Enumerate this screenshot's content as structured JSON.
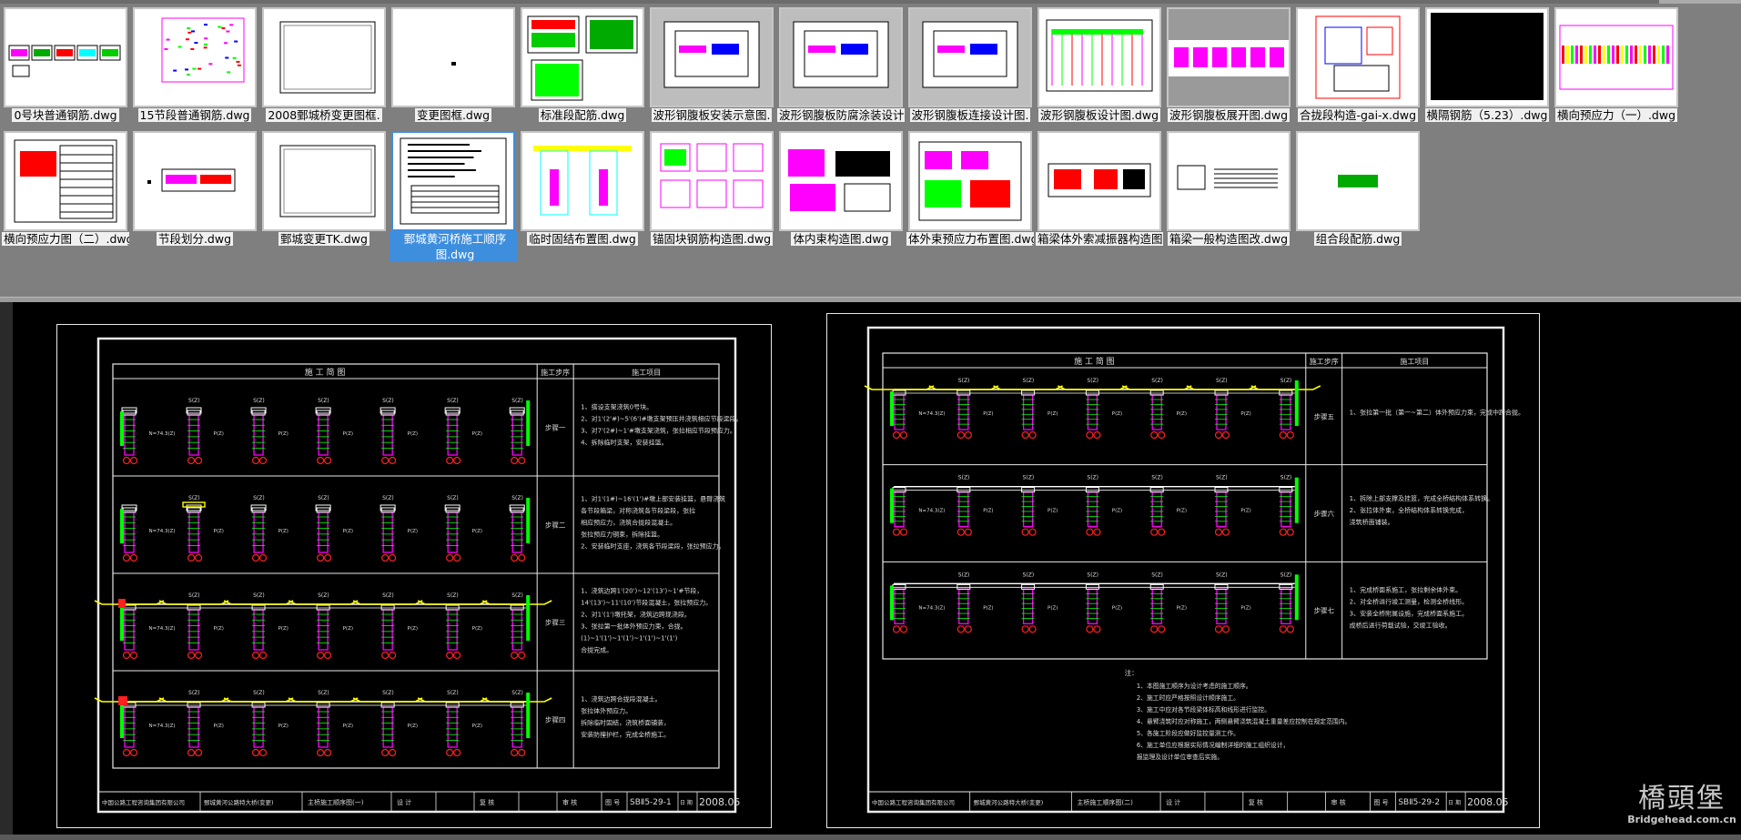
{
  "thumbnails": [
    {
      "label": "0号块普通钢筋.dwg",
      "selected": false,
      "style": "blank"
    },
    {
      "label": "15节段普通钢筋.dwg",
      "selected": false,
      "style": "rebar"
    },
    {
      "label": "2008鄄城桥变更图框.",
      "selected": false,
      "style": "frame"
    },
    {
      "label": "变更图框.dwg",
      "selected": false,
      "style": "dot"
    },
    {
      "label": "标准段配筋.dwg",
      "selected": false,
      "style": "multi"
    },
    {
      "label": "波形钢腹板安装示意图.",
      "selected": false,
      "style": "grey"
    },
    {
      "label": "波形钢腹板防腐涂装设计",
      "selected": false,
      "style": "grey"
    },
    {
      "label": "波形钢腹板连接设计图.",
      "selected": false,
      "style": "grey"
    },
    {
      "label": "波形钢腹板设计图.dwg",
      "selected": false,
      "style": "design"
    },
    {
      "label": "波形钢腹板展开图.dwg",
      "selected": false,
      "style": "greyband"
    },
    {
      "label": "合拢段构造-gai-x.dwg",
      "selected": false,
      "style": "redframe"
    },
    {
      "label": "横隔钢筋（5.23）.dwg",
      "selected": false,
      "style": "black"
    },
    {
      "label": "横向预应力（一）.dwg",
      "selected": false,
      "style": "prestress"
    },
    {
      "label": "横向预应力图（二）.dwg",
      "selected": false,
      "style": "table"
    },
    {
      "label": "节段划分.dwg",
      "selected": false,
      "style": "segment"
    },
    {
      "label": "鄄城变更TK.dwg",
      "selected": false,
      "style": "frame"
    },
    {
      "label": "鄄城黄河桥施工顺序图.dwg",
      "selected": true,
      "style": "text"
    },
    {
      "label": "临时固结布置图.dwg",
      "selected": false,
      "style": "temp"
    },
    {
      "label": "锚固块钢筋构造图.dwg",
      "selected": false,
      "style": "anchor"
    },
    {
      "label": "体内束构造图.dwg",
      "selected": false,
      "style": "internal"
    },
    {
      "label": "体外束预应力布置图.dwg",
      "selected": false,
      "style": "external"
    },
    {
      "label": "箱梁体外索减振器构造图.",
      "selected": false,
      "style": "damper"
    },
    {
      "label": "箱梁一般构造图改.dwg",
      "selected": false,
      "style": "general"
    },
    {
      "label": "组合段配筋.dwg",
      "selected": false,
      "style": "combo"
    }
  ],
  "preview": {
    "sheet1": {
      "header_diagram": "施  工  简  图",
      "header_step": "施工步序",
      "header_items": "施工项目",
      "steps": [
        {
          "name": "步骤一",
          "lines": [
            "1、搭设支架浇筑0号块。",
            "2、对1'(2'#)~5'(6')#墩支架预压并浇筑相应节段梁段。",
            "3、对7'(2#)~1'#墩支架浇筑，张拉相应节段预应力。",
            "4、拆除临时支架，安装挂篮。"
          ]
        },
        {
          "name": "步骤二",
          "lines": [
            "1、对1'(1#)~16'(1')#墩上部安装挂篮，悬臂浇筑",
            "   各节段箱梁，对称浇筑各节段梁段，张拉",
            "   相应预应力，浇筑合拢段混凝土。",
            "   张拉预应力钢束，拆除挂篮。",
            "2、安装临时支座，浇筑各节段梁段，张拉预应力。"
          ]
        },
        {
          "name": "步骤三",
          "lines": [
            "1、浇筑边跨1'(20')~12'(13')~1'#节段，",
            "   14'(13')~11'(10')节段混凝土，张拉预应力。",
            "2、对1'(1')墩托架，浇筑边跨现浇段。",
            "3、张拉第一批体外预应力束，合拢。",
            "   (1)~1'(1')~1'(1')~1'(1')~1'(1')",
            "   合拢完成。"
          ]
        },
        {
          "name": "步骤四",
          "lines": [
            "1、浇筑边跨合拢段混凝土。",
            "   张拉体外预应力。",
            "   拆除临时固结，浇筑桥面铺装，",
            "   安装防撞护栏，完成全桥施工。"
          ]
        }
      ],
      "pier_labels": [
        "S(Z)",
        "S(Z)",
        "S(Z)",
        "S(Z)",
        "S(Z)",
        "S(Z)"
      ],
      "span_labels": [
        "N=74.3(Z)",
        "P(Z)",
        "P(Z)",
        "P(Z)",
        "P(Z)",
        "P(Z)"
      ],
      "title_block": {
        "company": "中国公路工程咨询集团有限公司",
        "project": "鄄城黄河公路特大桥(变更)",
        "drawing": "主桥施工顺序图(一)",
        "design": "设 计",
        "check": "复 核",
        "review": "审 核",
        "drawing_no_label": "图 号",
        "drawing_no": "SBⅡ5-29-1",
        "date_label": "日 期",
        "date": "2008.05"
      }
    },
    "sheet2": {
      "header_diagram": "施  工  简  图",
      "header_step": "施工步序",
      "header_items": "施工项目",
      "steps": [
        {
          "name": "步骤五",
          "lines": [
            "1、张拉第一批（第一~第二）体外预应力束，完成中跨合拢。"
          ]
        },
        {
          "name": "步骤六",
          "lines": [
            "1、拆除上部支撑及挂篮，完成全桥结构体系转换。",
            "2、张拉体外束，全桥结构体系转换完成，",
            "   浇筑桥面铺装。"
          ]
        },
        {
          "name": "步骤七",
          "lines": [
            "1、完成桥面系施工，张拉剩余体外束。",
            "2、对全桥进行竣工测量，检测全桥线形。",
            "3、安装全桥附属设施，完成桥面系施工。",
            "   成桥后进行荷载试验，交竣工验收。"
          ]
        }
      ],
      "notes_title": "注：",
      "notes": [
        "1、本图施工顺序为设计考虑的施工顺序。",
        "2、施工时应严格按照设计顺序施工。",
        "3、施工中应对各节段梁体标高和线形进行监控。",
        "4、悬臂浇筑时应对称施工，两侧悬臂浇筑混凝土重量差应控制在规定范围内。",
        "5、各施工阶段应做好监控量测工作。",
        "6、施工单位应根据实际情况编制详细的施工组织设计，",
        "   报监理及设计单位审查后实施。"
      ],
      "title_block": {
        "company": "中国公路工程咨询集团有限公司",
        "project": "鄄城黄河公路特大桥(变更)",
        "drawing": "主桥施工顺序图(二)",
        "design": "设 计",
        "check": "复 核",
        "review": "审 核",
        "drawing_no_label": "图 号",
        "drawing_no": "SBⅡ5-29-2",
        "date_label": "日 期",
        "date": "2008.05"
      }
    }
  },
  "watermark": {
    "name": "橋頭堡",
    "url": "Bridgehead.com.cn"
  },
  "colors": {
    "cad_bg": "#000000",
    "pier": "#ff00ff",
    "rebar": "#00ff00",
    "beam": "#ffff00",
    "select": "#3e8ede"
  }
}
